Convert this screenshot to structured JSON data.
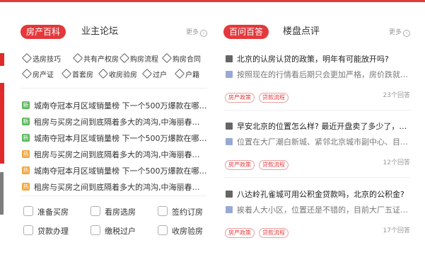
{
  "colors": {
    "accent": "#e4393c",
    "new_badge": "#5cb85c",
    "hot_badge": "#f0a53a",
    "question_icon": "#666666",
    "answer_icon": "#98a9d6"
  },
  "left": {
    "tab_active": "房产百科",
    "tab_inactive": "业主论坛",
    "more": "更多",
    "tags": [
      "选房技巧",
      "共有产权房",
      "购房流程",
      "购房合同",
      "房产证",
      "首套房",
      "收房验房",
      "过户",
      "户籍"
    ],
    "news": [
      {
        "badge": "新",
        "badge_color": "green",
        "text": "城南夺冠本月区域销量榜 下一个500万爆款在哪里..."
      },
      {
        "badge": "新",
        "badge_color": "green",
        "text": "租房与买房之间到底隔着多大的鸿沟,中海丽春湖墅..."
      },
      {
        "badge": "新",
        "badge_color": "green",
        "text": "城南夺冠本月区域销量榜 下一个500万爆款在哪里..."
      },
      {
        "badge": "热",
        "badge_color": "orange",
        "text": "租房与买房之间到底隔着多大的鸿沟,中海丽春湖墅..."
      },
      {
        "badge": "热",
        "badge_color": "orange",
        "text": "城南夺冠本月区域销量榜 下一个500万爆款在哪里..."
      },
      {
        "badge": "热",
        "badge_color": "orange",
        "text": "租房与买房之间到底隔着多大的鸿沟,中海丽春湖墅..."
      }
    ],
    "services": [
      "准备买房",
      "看房选房",
      "签约订房",
      "贷款办理",
      "缴税过户",
      "收房验房"
    ]
  },
  "right": {
    "tab_active": "百问百答",
    "tab_inactive": "楼盘点评",
    "more": "更多",
    "items": [
      {
        "question": "北京的认房认贷的政策，明年有可能放开吗?",
        "answer": "按照现在的行情看后期只会更加严格，房价跌就开...",
        "tags": [
          "房产政策",
          "贷款流程"
        ],
        "count": "23个回答"
      },
      {
        "question": "早安北京的位置怎么样? 最近开盘卖了多少了，北...",
        "answer": "位置在大厂潮白新城、紧邻北京城市副中心、目前...",
        "tags": [
          "房产政策",
          "贷款流程"
        ],
        "count": "12个回答"
      },
      {
        "question": "八达岭孔雀城可用公积金贷款吗，北京的公积金?",
        "answer": "挨着人大小区，位置还是不错的，目前大厂五证齐...",
        "tags": [
          "房产政策",
          "贷款流程"
        ],
        "count": "17个回答"
      }
    ]
  }
}
